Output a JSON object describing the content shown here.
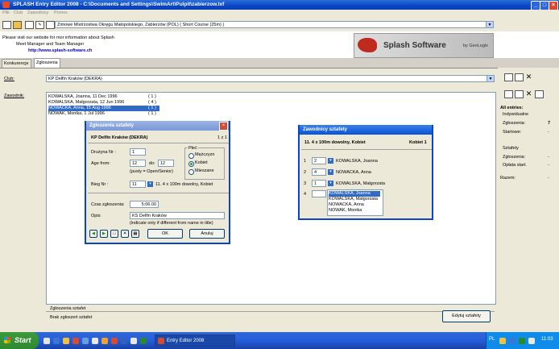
{
  "window": {
    "title": "SPLASH Entry Editor 2008 - C:\\Documents and Settings\\SwimArt\\Pulpit\\zabierzow.lxf"
  },
  "menu": [
    "Plik",
    "Club",
    "Zawodnicy",
    "Pomoc"
  ],
  "toolbar": {
    "meet_combo": "Zimowe Mistrzostwa Okręgu Małopolskiego, Zabierzów (POL)  ( Short Course (25m) )"
  },
  "banner": {
    "line1": "Please visit our website for mor information about Splash",
    "line2": "Meet Manager and Team Manager",
    "url": "http://www.splash-software.ch",
    "logo_text": "Splash Software",
    "logo_by": "by GeoLogix"
  },
  "tabs": [
    {
      "label": "Konkurencje"
    },
    {
      "label": "Zgłoszenia"
    }
  ],
  "main": {
    "club_label": "Club:",
    "club_value": "KP Delfin Kraków (DEKRA)",
    "swimmer_label": "Zawodnik:",
    "swimmers": [
      {
        "name": "KOWALSKA, Joanna, 11 Dec 1996",
        "count": "( 1 )"
      },
      {
        "name": "KOWALSKA, Małgorzata, 12 Jun 1996",
        "count": "( 4 )"
      },
      {
        "name": "NOWACKA, Anna, 15 Aug 1996",
        "count": "( 1 )"
      },
      {
        "name": "NOWAK, Monika, 1 Jul 1996",
        "count": "( 1 )"
      }
    ],
    "relay_section_label": "Zgłoszenia sztafet",
    "relay_none": "Brak zgłoszeń sztafet",
    "edit_relays_button": "Edytuj sztafety"
  },
  "right_panel": {
    "all_entries": "All entries:",
    "individual_group": "Indywidualne",
    "entries_label": "Zgłoszenia:",
    "entries_value": "7",
    "starts_label": "Startowe:",
    "starts_value": "-",
    "relays_group": "Sztafety",
    "relay_entries_label": "Zgłoszenia:",
    "relay_entries_value": "-",
    "relay_fee_label": "Opłata start.",
    "relay_fee_value": "-",
    "total_label": "Razem:",
    "total_value": "-"
  },
  "relay_dialog": {
    "title": "Zgłoszenia sztafety",
    "club": "KP Delfin Kraków (DEKRA)",
    "counter": "1 z 1",
    "team_no_label": "Drużyna Nr :",
    "team_no_value": "1",
    "age_from_label": "Age from:",
    "age_from_value": "12",
    "age_to_label": "do:",
    "age_to_value": "12",
    "age_hint": "(pusty = Open/Senior)",
    "gender_group": "Płeć",
    "gender_male": "Mężczyzn",
    "gender_female": "Kobiet",
    "gender_mixed": "Mieszane",
    "event_label": "Bieg Nr :",
    "event_value": "11",
    "event_desc": "11. 4 x 100m dowolny, Kobiet",
    "time_label": "Czas zgłoszenia:",
    "time_value": "5:06.00",
    "desc_label": "Opis:",
    "desc_value": "KS Delfin Kraków",
    "desc_hint": "(indicate only if different from name in title)",
    "ok_button": "OK",
    "cancel_button": "Anuluj"
  },
  "members_dialog": {
    "title": "Zawodnicy sztafety",
    "event": "11.  4 x 100m dowolny, Kobiet",
    "team": "Kobiet 1",
    "legs": [
      {
        "no": "1",
        "value": "2",
        "name": "KOWALSKA, Joanna"
      },
      {
        "no": "2",
        "value": "4",
        "name": "NOWACKA, Anna"
      },
      {
        "no": "3",
        "value": "1",
        "name": "KOWALSKA, Małgorzata"
      },
      {
        "no": "4",
        "value": "",
        "name": ""
      }
    ],
    "dropdown_options": [
      "KOWALSKA, Joanna",
      "KOWALSKA, Małgorzata",
      "NOWACKA, Anna",
      "NOWAK, Monika"
    ]
  },
  "taskbar": {
    "start": "Start",
    "app_button": "Entry Editor 2008",
    "lang": "PL",
    "clock": "11:03"
  }
}
